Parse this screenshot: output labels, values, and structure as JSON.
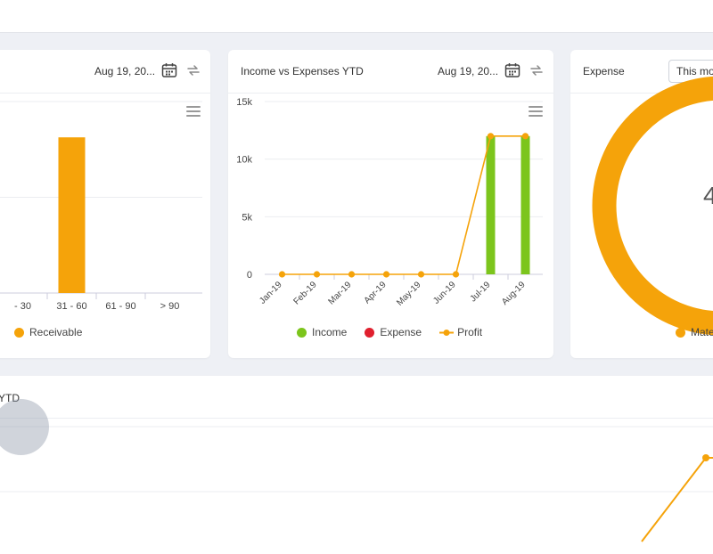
{
  "colors": {
    "orange": "#f5a30a",
    "green": "#7cc51c",
    "red": "#e0202e",
    "grid": "#ebedf0",
    "axis_text": "#444"
  },
  "aging_card": {
    "date_label": "Aug 19, 20...",
    "legend": "Receivable"
  },
  "ivx_card": {
    "title": "Income vs Expenses YTD",
    "date_label": "Aug 19, 20...",
    "legend": {
      "income": "Income",
      "expense": "Expense",
      "profit": "Profit"
    }
  },
  "expense_card": {
    "title": "Expense",
    "period_select": "This mo",
    "center_value": "4",
    "legend": "Mate"
  },
  "bottom_card": {
    "title_fragment": "YTD"
  },
  "chart_data": [
    {
      "type": "bar",
      "categories": [
        "- 30",
        "31 - 60",
        "61 - 90",
        "> 90"
      ],
      "series": [
        {
          "name": "Receivable",
          "values": [
            null,
            11000,
            0,
            0
          ]
        }
      ],
      "legend": "bottom"
    },
    {
      "type": "bar",
      "title": "Income vs Expenses YTD",
      "categories": [
        "Jan-19",
        "Feb-19",
        "Mar-19",
        "Apr-19",
        "May-19",
        "Jun-19",
        "Jul-19",
        "Aug-19"
      ],
      "yticks": [
        "0",
        "5k",
        "10k",
        "15k"
      ],
      "ylim": [
        0,
        15000
      ],
      "series": [
        {
          "name": "Income",
          "type": "bar",
          "values": [
            0,
            0,
            0,
            0,
            0,
            0,
            12000,
            12000
          ]
        },
        {
          "name": "Expense",
          "type": "bar",
          "values": [
            0,
            0,
            0,
            0,
            0,
            0,
            0,
            0
          ]
        },
        {
          "name": "Profit",
          "type": "line",
          "values": [
            0,
            0,
            0,
            0,
            0,
            0,
            12000,
            12000
          ]
        }
      ],
      "legend": "bottom"
    },
    {
      "type": "pie",
      "series": [
        {
          "name": "Mate",
          "values": [
            100
          ]
        }
      ],
      "legend": "bottom"
    }
  ]
}
